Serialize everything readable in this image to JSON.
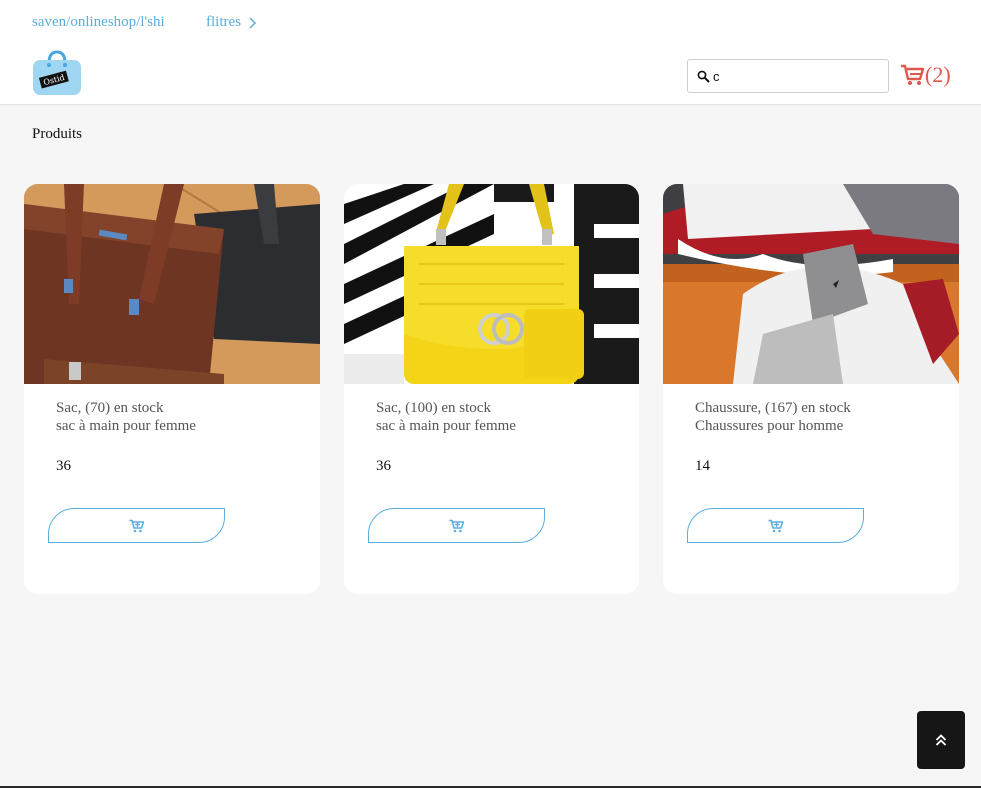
{
  "header": {
    "breadcrumb_path": "saven/onlineshop/l'shi",
    "filters_label": "flitres",
    "logo_text": "Ostid",
    "search": {
      "value": "c",
      "placeholder": ""
    },
    "cart_count": "(2)"
  },
  "section_title": "Produits",
  "products": [
    {
      "title": "Sac, (70) en stock",
      "description": "sac à main pour femme",
      "price": "36",
      "image": "brown-black-handbags"
    },
    {
      "title": "Sac, (100) en stock",
      "description": "sac à main pour femme",
      "price": "36",
      "image": "yellow-quilted-bag"
    },
    {
      "title": "Chaussure, (167) en stock",
      "description": "Chaussures pour homme",
      "price": "14",
      "image": "red-white-sneakers"
    }
  ],
  "colors": {
    "accent": "#5aaee0",
    "cart": "#e0584c",
    "dark_button": "#161616"
  },
  "icons": [
    "search-icon",
    "cart-icon",
    "chevron-right-icon",
    "add-to-cart-icon",
    "double-chevron-up-icon",
    "shopping-bag-logo"
  ]
}
